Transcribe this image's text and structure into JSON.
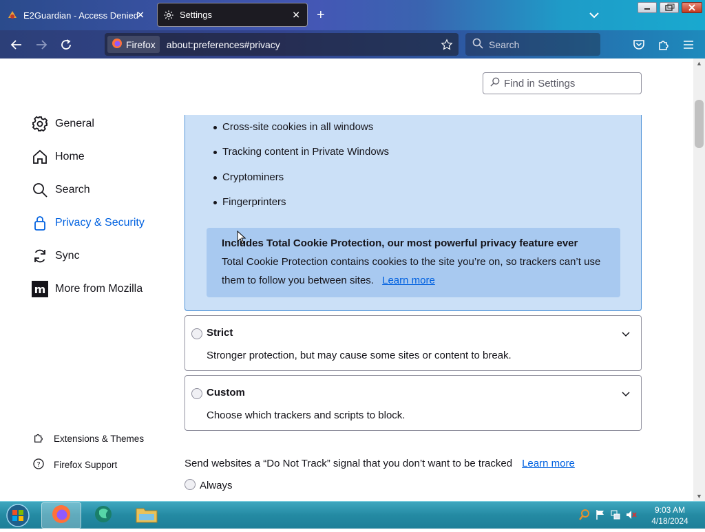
{
  "browser": {
    "tabs": [
      {
        "label": "E2Guardian - Access Denied"
      },
      {
        "label": "Settings"
      }
    ],
    "identity_label": "Firefox",
    "url": "about:preferences#privacy",
    "search_placeholder": "Search"
  },
  "settings": {
    "find_placeholder": "Find in Settings",
    "categories": [
      {
        "label": "General",
        "icon": "gear-icon"
      },
      {
        "label": "Home",
        "icon": "home-icon"
      },
      {
        "label": "Search",
        "icon": "search-icon"
      },
      {
        "label": "Privacy & Security",
        "icon": "lock-icon",
        "selected": true
      },
      {
        "label": "Sync",
        "icon": "sync-icon"
      },
      {
        "label": "More from Mozilla",
        "icon": "mozilla-icon"
      }
    ],
    "footer_links": [
      {
        "label": "Extensions & Themes",
        "icon": "puzzle-icon"
      },
      {
        "label": "Firefox Support",
        "icon": "help-icon"
      }
    ],
    "standard": {
      "bullets": [
        "Cross-site cookies in all windows",
        "Tracking content in Private Windows",
        "Cryptominers",
        "Fingerprinters"
      ],
      "tcp_title": "Includes Total Cookie Protection, our most powerful privacy feature ever",
      "tcp_text": "Total Cookie Protection contains cookies to the site you’re on, so trackers can’t use them to follow you between sites.",
      "learn_more": "Learn more"
    },
    "strict": {
      "label": "Strict",
      "description": "Stronger protection, but may cause some sites or content to break."
    },
    "custom": {
      "label": "Custom",
      "description": "Choose which trackers and scripts to block."
    },
    "dnt": {
      "text": "Send websites a “Do Not Track” signal that you don’t want to be tracked",
      "learn_more": "Learn more",
      "always": "Always"
    }
  },
  "taskbar": {
    "time": "9:03 AM",
    "date": "4/18/2024"
  },
  "colors": {
    "accent": "#0061e0",
    "panel": "#cbe0f7",
    "callout": "#a8c9f0"
  }
}
